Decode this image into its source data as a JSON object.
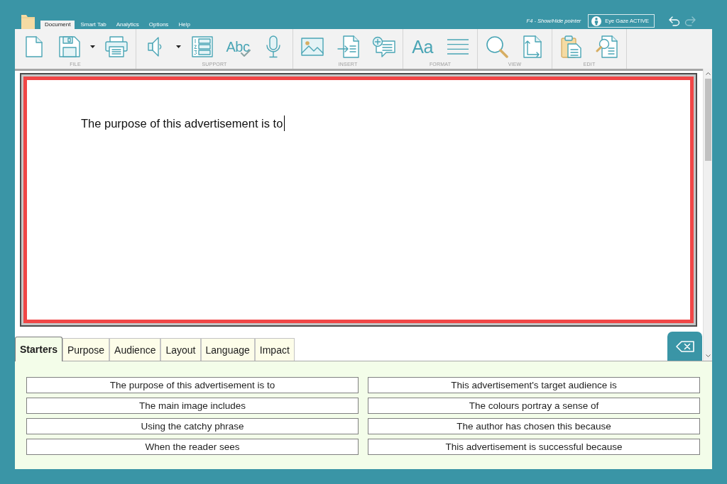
{
  "app_menu": {
    "tabs": [
      {
        "label": "Document",
        "selected": true
      },
      {
        "label": "Smart Tab",
        "selected": false
      },
      {
        "label": "Analytics",
        "selected": false
      },
      {
        "label": "Options",
        "selected": false
      },
      {
        "label": "Help",
        "selected": false
      }
    ]
  },
  "pointer_hint": "F4 - Show/Hide pointer",
  "eye_gaze_button": {
    "label": "Eye Gaze ACTIVE"
  },
  "history_buttons": [
    {
      "kind": "undo",
      "disabled": false
    },
    {
      "kind": "redo",
      "disabled": true
    }
  ],
  "ribbon": {
    "groups": [
      {
        "label": "FILE",
        "tools": [
          {
            "kind": "new",
            "dropdown": false
          },
          {
            "kind": "save",
            "dropdown": true
          },
          {
            "kind": "print",
            "dropdown": false
          }
        ]
      },
      {
        "label": "SUPPORT",
        "tools": [
          {
            "kind": "speak",
            "dropdown": true
          },
          {
            "kind": "numbered-list",
            "dropdown": false
          },
          {
            "kind": "spelling",
            "glyph": "Abc",
            "dropdown": false
          },
          {
            "kind": "dictate",
            "dropdown": false
          }
        ]
      },
      {
        "label": "INSERT",
        "tools": [
          {
            "kind": "picture",
            "dropdown": false
          },
          {
            "kind": "import",
            "dropdown": false
          },
          {
            "kind": "comment",
            "dropdown": false
          }
        ]
      },
      {
        "label": "FORMAT",
        "tools": [
          {
            "kind": "font",
            "glyph": "Aa",
            "dropdown": false
          },
          {
            "kind": "align",
            "dropdown": false
          }
        ]
      },
      {
        "label": "VIEW",
        "tools": [
          {
            "kind": "zoom",
            "dropdown": false
          },
          {
            "kind": "page-setup",
            "dropdown": false
          }
        ]
      },
      {
        "label": "EDIT",
        "tools": [
          {
            "kind": "paste",
            "dropdown": false
          },
          {
            "kind": "find",
            "dropdown": false
          }
        ]
      }
    ]
  },
  "document": {
    "text": "The purpose of this advertisement is to"
  },
  "word_bank": {
    "tabs": [
      {
        "label": "Starters",
        "selected": true
      },
      {
        "label": "Purpose",
        "selected": false
      },
      {
        "label": "Audience",
        "selected": false
      },
      {
        "label": "Layout",
        "selected": false
      },
      {
        "label": "Language",
        "selected": false
      },
      {
        "label": "Impact",
        "selected": false
      }
    ],
    "starters": [
      "The purpose of this advertisement is to",
      "This advertisement's target audience is",
      "The main image includes",
      "The colours portray a sense of",
      "Using the catchy phrase",
      "The author has chosen this because",
      "When the reader sees",
      "This advertisement is successful because"
    ]
  }
}
